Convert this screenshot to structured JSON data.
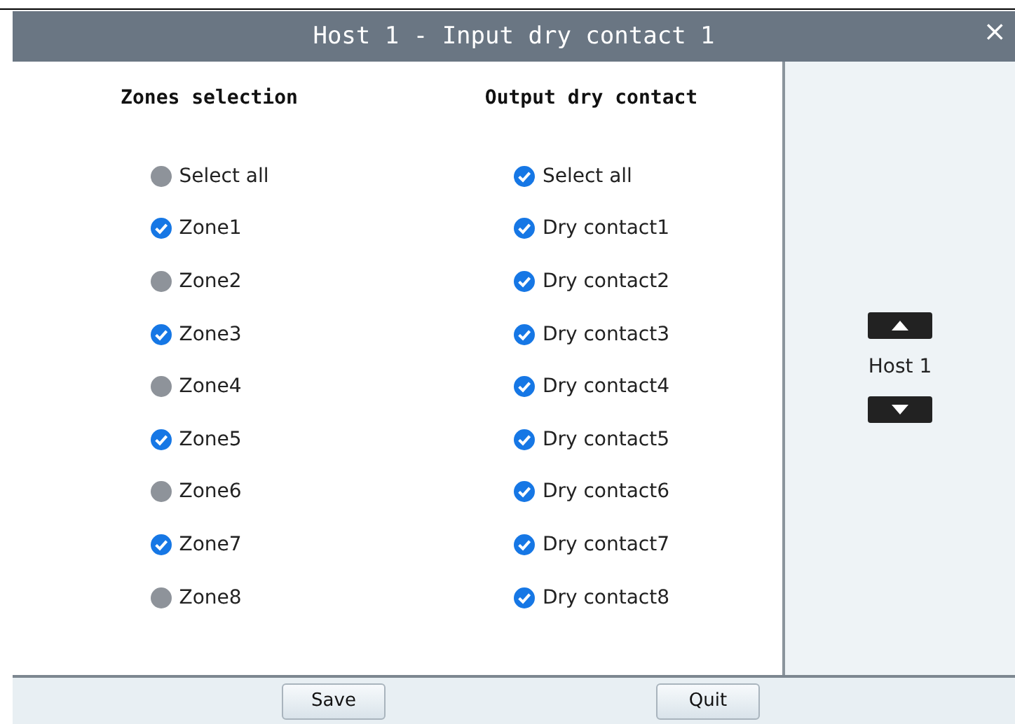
{
  "window": {
    "title": "Host 1 - Input dry contact 1",
    "close": "×"
  },
  "columns": [
    {
      "heading": "Zones selection",
      "items": [
        {
          "label": "Select all",
          "checked": false
        },
        {
          "label": "Zone1",
          "checked": true
        },
        {
          "label": "Zone2",
          "checked": false
        },
        {
          "label": "Zone3",
          "checked": true
        },
        {
          "label": "Zone4",
          "checked": false
        },
        {
          "label": "Zone5",
          "checked": true
        },
        {
          "label": "Zone6",
          "checked": false
        },
        {
          "label": "Zone7",
          "checked": true
        },
        {
          "label": "Zone8",
          "checked": false
        }
      ]
    },
    {
      "heading": "Output dry contact",
      "items": [
        {
          "label": "Select all",
          "checked": true
        },
        {
          "label": "Dry contact1",
          "checked": true
        },
        {
          "label": "Dry contact2",
          "checked": true
        },
        {
          "label": "Dry contact3",
          "checked": true
        },
        {
          "label": "Dry contact4",
          "checked": true
        },
        {
          "label": "Dry contact5",
          "checked": true
        },
        {
          "label": "Dry contact6",
          "checked": true
        },
        {
          "label": "Dry contact7",
          "checked": true
        },
        {
          "label": "Dry contact8",
          "checked": true
        }
      ]
    }
  ],
  "host_selector": {
    "label": "Host 1"
  },
  "buttons": [
    "Save",
    "Quit"
  ]
}
